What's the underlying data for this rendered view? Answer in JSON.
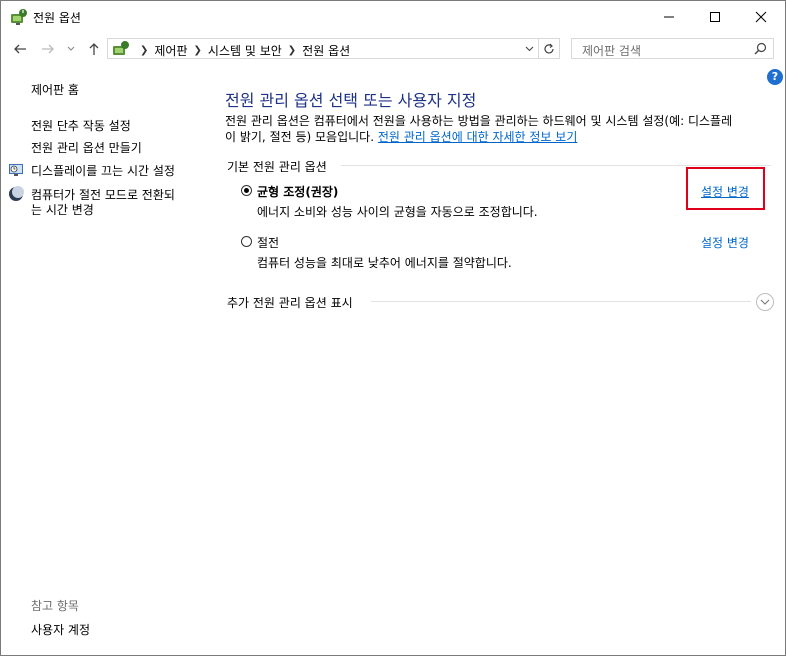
{
  "window": {
    "title": "전원 옵션",
    "buttons": {
      "minimize": "minimize-icon",
      "maximize": "maximize-icon",
      "close": "close-icon"
    }
  },
  "nav": {
    "back": "back-arrow-icon",
    "forward": "forward-arrow-icon",
    "recent": "chevron-down-icon",
    "up": "up-arrow-icon"
  },
  "address": {
    "crumbs": [
      "제어판",
      "시스템 및 보안",
      "전원 옵션"
    ]
  },
  "search": {
    "placeholder": "제어판 검색"
  },
  "sidebar": {
    "home": "제어판 홈",
    "links": [
      {
        "label": "전원 단추 작동 설정"
      },
      {
        "label": "전원 관리 옵션 만들기"
      },
      {
        "label": "디스플레이를 끄는 시간 설정",
        "icon": "display-clock-icon"
      },
      {
        "label_line1": "컴퓨터가 절전 모드로 전환되",
        "label_line2": "는 시간 변경",
        "icon": "moon-icon"
      }
    ],
    "see_also": {
      "heading": "참고 항목",
      "items": [
        "사용자 계정"
      ]
    }
  },
  "main": {
    "title": "전원 관리 옵션 선택 또는 사용자 지정",
    "description_line1": "전원 관리 옵션은 컴퓨터에서 전원을 사용하는 방법을 관리하는 하드웨어 및 시스템 설정(예: 디스플레",
    "description_line2": "이 밝기, 절전 등) 모음입니다.",
    "description_link": "전원 관리 옵션에 대한 자세한 정보 보기",
    "group_label": "기본 전원 관리 옵션",
    "plans": [
      {
        "name": "균형 조정(권장)",
        "selected": true,
        "description": "에너지 소비와 성능 사이의 균형을 자동으로 조정합니다.",
        "change_link": "설정 변경"
      },
      {
        "name": "절전",
        "selected": false,
        "description": "컴퓨터 성능을 최대로 낮추어 에너지를 절약합니다.",
        "change_link": "설정 변경"
      }
    ],
    "more_plans": "추가 전원 관리 옵션 표시"
  },
  "colors": {
    "title_blue": "#1e3287",
    "link_blue": "#0066cc",
    "highlight_red": "#e0001b"
  }
}
